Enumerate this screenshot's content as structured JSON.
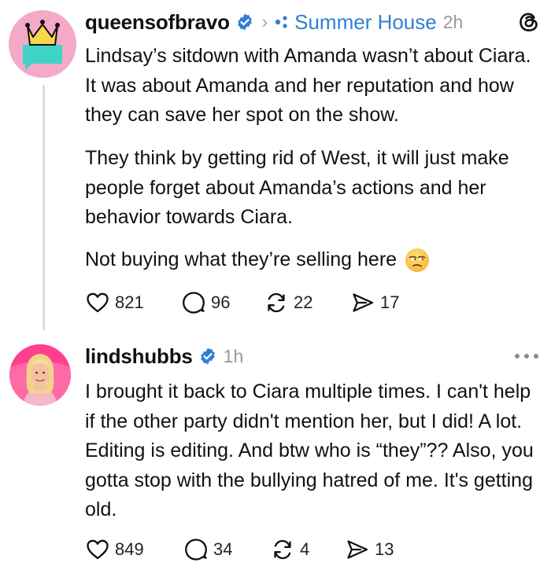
{
  "posts": [
    {
      "username": "queensofbravo",
      "community": "Summer House",
      "time": "2h",
      "paragraphs": [
        "Lindsay’s sitdown with Amanda wasn’t about Ciara. It was about Amanda and her reputation and how they can save her spot on the show.",
        "They think by getting rid of West, it will just make people forget about Amanda’s actions and her behavior towards Ciara.",
        "Not buying what they’re selling here"
      ],
      "emoji": "unamused-face",
      "counts": {
        "likes": "821",
        "replies": "96",
        "reposts": "22",
        "shares": "17"
      }
    },
    {
      "username": "lindshubbs",
      "time": "1h",
      "text": "I brought it back to Ciara multiple times. I can't help if the other party didn't mention her, but I did! A lot. Editing is editing. And btw who is “they”?? Also, you gotta stop with the bullying hatred of me. It's getting old.",
      "counts": {
        "likes": "849",
        "replies": "34",
        "reposts": "4",
        "shares": "13"
      }
    }
  ],
  "colors": {
    "verified": "#2f7fd6",
    "community": "#2f7fd6",
    "muted": "#9a9a9a",
    "thread_line": "#dcdcdc"
  },
  "icons": [
    "verified-badge-icon",
    "chevron-right-icon",
    "community-dots-icon",
    "threads-logo-icon",
    "more-options-icon",
    "heart-icon",
    "reply-icon",
    "repost-icon",
    "share-icon"
  ]
}
